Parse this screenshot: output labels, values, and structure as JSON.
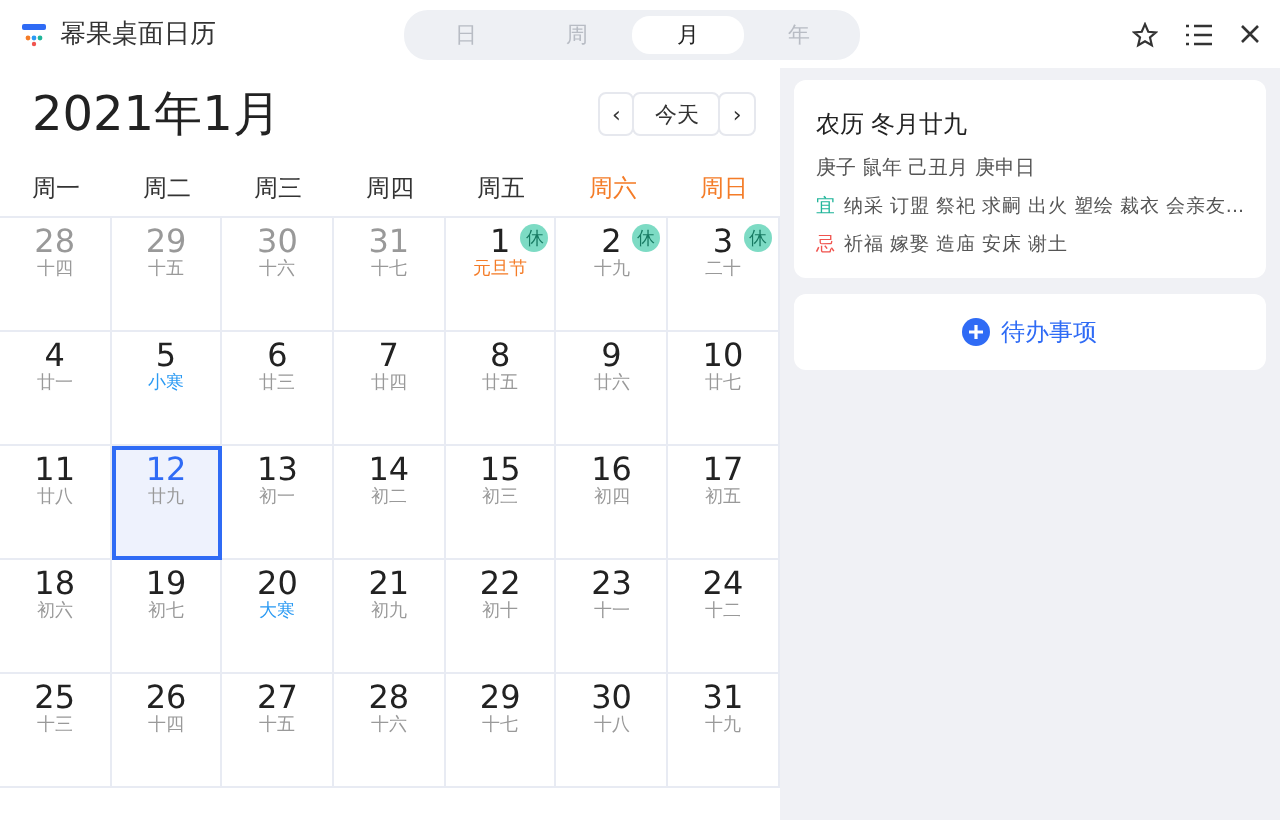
{
  "app": {
    "title": "幂果桌面日历"
  },
  "views": [
    {
      "label": "日",
      "selected": false
    },
    {
      "label": "周",
      "selected": false
    },
    {
      "label": "月",
      "selected": true
    },
    {
      "label": "年",
      "selected": false
    }
  ],
  "month_title": "2021年1月",
  "nav": {
    "prev": "‹",
    "today": "今天",
    "next": "›"
  },
  "weekdays": [
    {
      "label": "周一",
      "weekend": false
    },
    {
      "label": "周二",
      "weekend": false
    },
    {
      "label": "周三",
      "weekend": false
    },
    {
      "label": "周四",
      "weekend": false
    },
    {
      "label": "周五",
      "weekend": false
    },
    {
      "label": "周六",
      "weekend": true
    },
    {
      "label": "周日",
      "weekend": true
    }
  ],
  "weeks": [
    [
      {
        "day": "28",
        "lunar": "十四",
        "kind": "plain",
        "muted": true,
        "selected": false
      },
      {
        "day": "29",
        "lunar": "十五",
        "kind": "plain",
        "muted": true,
        "selected": false
      },
      {
        "day": "30",
        "lunar": "十六",
        "kind": "plain",
        "muted": true,
        "selected": false
      },
      {
        "day": "31",
        "lunar": "十七",
        "kind": "plain",
        "muted": true,
        "selected": false
      },
      {
        "day": "1",
        "lunar": "元旦节",
        "kind": "festival",
        "muted": false,
        "selected": false,
        "badge": "休"
      },
      {
        "day": "2",
        "lunar": "十九",
        "kind": "plain",
        "muted": false,
        "selected": false,
        "badge": "休"
      },
      {
        "day": "3",
        "lunar": "二十",
        "kind": "plain",
        "muted": false,
        "selected": false,
        "badge": "休"
      }
    ],
    [
      {
        "day": "4",
        "lunar": "廿一",
        "kind": "plain",
        "muted": false,
        "selected": false
      },
      {
        "day": "5",
        "lunar": "小寒",
        "kind": "term",
        "muted": false,
        "selected": false
      },
      {
        "day": "6",
        "lunar": "廿三",
        "kind": "plain",
        "muted": false,
        "selected": false
      },
      {
        "day": "7",
        "lunar": "廿四",
        "kind": "plain",
        "muted": false,
        "selected": false
      },
      {
        "day": "8",
        "lunar": "廿五",
        "kind": "plain",
        "muted": false,
        "selected": false
      },
      {
        "day": "9",
        "lunar": "廿六",
        "kind": "plain",
        "muted": false,
        "selected": false
      },
      {
        "day": "10",
        "lunar": "廿七",
        "kind": "plain",
        "muted": false,
        "selected": false
      }
    ],
    [
      {
        "day": "11",
        "lunar": "廿八",
        "kind": "plain",
        "muted": false,
        "selected": false
      },
      {
        "day": "12",
        "lunar": "廿九",
        "kind": "plain",
        "muted": false,
        "selected": true
      },
      {
        "day": "13",
        "lunar": "初一",
        "kind": "plain",
        "muted": false,
        "selected": false
      },
      {
        "day": "14",
        "lunar": "初二",
        "kind": "plain",
        "muted": false,
        "selected": false
      },
      {
        "day": "15",
        "lunar": "初三",
        "kind": "plain",
        "muted": false,
        "selected": false
      },
      {
        "day": "16",
        "lunar": "初四",
        "kind": "plain",
        "muted": false,
        "selected": false
      },
      {
        "day": "17",
        "lunar": "初五",
        "kind": "plain",
        "muted": false,
        "selected": false
      }
    ],
    [
      {
        "day": "18",
        "lunar": "初六",
        "kind": "plain",
        "muted": false,
        "selected": false
      },
      {
        "day": "19",
        "lunar": "初七",
        "kind": "plain",
        "muted": false,
        "selected": false
      },
      {
        "day": "20",
        "lunar": "大寒",
        "kind": "term",
        "muted": false,
        "selected": false
      },
      {
        "day": "21",
        "lunar": "初九",
        "kind": "plain",
        "muted": false,
        "selected": false
      },
      {
        "day": "22",
        "lunar": "初十",
        "kind": "plain",
        "muted": false,
        "selected": false
      },
      {
        "day": "23",
        "lunar": "十一",
        "kind": "plain",
        "muted": false,
        "selected": false
      },
      {
        "day": "24",
        "lunar": "十二",
        "kind": "plain",
        "muted": false,
        "selected": false
      }
    ],
    [
      {
        "day": "25",
        "lunar": "十三",
        "kind": "plain",
        "muted": false,
        "selected": false
      },
      {
        "day": "26",
        "lunar": "十四",
        "kind": "plain",
        "muted": false,
        "selected": false
      },
      {
        "day": "27",
        "lunar": "十五",
        "kind": "plain",
        "muted": false,
        "selected": false
      },
      {
        "day": "28",
        "lunar": "十六",
        "kind": "plain",
        "muted": false,
        "selected": false
      },
      {
        "day": "29",
        "lunar": "十七",
        "kind": "plain",
        "muted": false,
        "selected": false
      },
      {
        "day": "30",
        "lunar": "十八",
        "kind": "plain",
        "muted": false,
        "selected": false
      },
      {
        "day": "31",
        "lunar": "十九",
        "kind": "plain",
        "muted": false,
        "selected": false
      }
    ]
  ],
  "detail": {
    "lunar_date": "农历 冬月廿九",
    "ganzhi": "庚子 鼠年 己丑月 庚申日",
    "almanac": [
      {
        "kind": "good",
        "mark": "宜",
        "items": "纳采 订盟 祭祀 求嗣 出火 塑绘 裁衣 会亲友..."
      },
      {
        "kind": "bad",
        "mark": "忌",
        "items": "祈福 嫁娶 造庙 安床 谢土"
      }
    ]
  },
  "todo": {
    "label": "待办事项"
  }
}
